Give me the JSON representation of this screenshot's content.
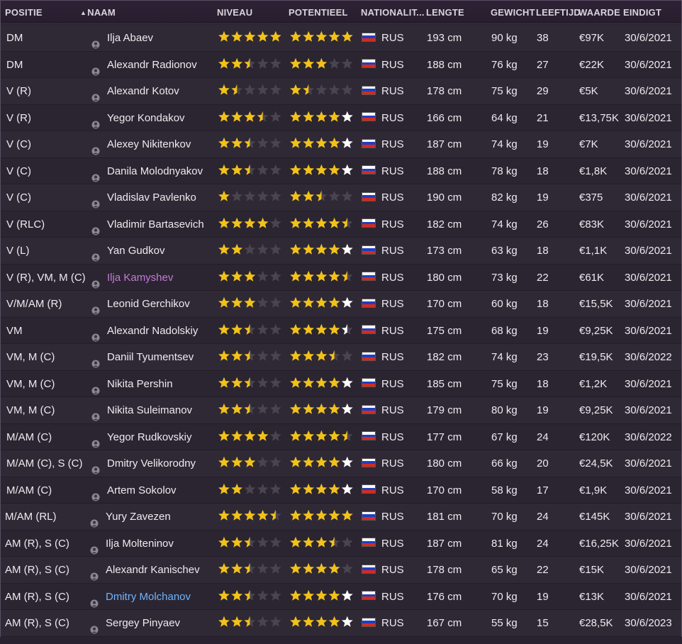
{
  "colors": {
    "header_bg": "#2b2131",
    "row_bg": "#2f2935",
    "star_gold": "#f2c21b",
    "star_white": "#ffffff",
    "star_empty": "#4a4450",
    "name_default": "#ecebee",
    "name_purple": "#c57ad9",
    "name_blue": "#6fb3ff"
  },
  "columns": [
    {
      "label": "POSITIE"
    },
    {
      "label": "NAAM",
      "sort_icon": "triangle-up-icon"
    },
    {
      "label": "NIVEAU"
    },
    {
      "label": "POTENTIEEL"
    },
    {
      "label": "NATIONALIT..."
    },
    {
      "label": "LENGTE"
    },
    {
      "label": "GEWICHT"
    },
    {
      "label": "LEEFTIJD"
    },
    {
      "label": "WAARDE"
    },
    {
      "label": "EINDIGT"
    }
  ],
  "players": [
    {
      "pos": "DM",
      "name": "Ilja Abaev",
      "niveau": 5,
      "pot": 5,
      "pot_white": false,
      "nat": "RUS",
      "len": "193 cm",
      "gew": "90 kg",
      "age": "38",
      "val": "€97K",
      "end": "30/6/2021"
    },
    {
      "pos": "DM",
      "name": "Alexandr Radionov",
      "niveau": 2.5,
      "pot": 3,
      "pot_white": false,
      "nat": "RUS",
      "len": "188 cm",
      "gew": "76 kg",
      "age": "27",
      "val": "€22K",
      "end": "30/6/2021"
    },
    {
      "pos": "V (R)",
      "name": "Alexandr Kotov",
      "niveau": 1.5,
      "pot": 1.5,
      "pot_white": false,
      "nat": "RUS",
      "len": "178 cm",
      "gew": "75 kg",
      "age": "29",
      "val": "€5K",
      "end": "30/6/2021"
    },
    {
      "pos": "V (R)",
      "name": "Yegor Kondakov",
      "niveau": 3.5,
      "pot": 5,
      "pot_white": true,
      "nat": "RUS",
      "len": "166 cm",
      "gew": "64 kg",
      "age": "21",
      "val": "€13,75K",
      "end": "30/6/2021"
    },
    {
      "pos": "V (C)",
      "name": "Alexey Nikitenkov",
      "niveau": 2.5,
      "pot": 5,
      "pot_white": true,
      "nat": "RUS",
      "len": "187 cm",
      "gew": "74 kg",
      "age": "19",
      "val": "€7K",
      "end": "30/6/2021"
    },
    {
      "pos": "V (C)",
      "name": "Danila Molodnyakov",
      "niveau": 2.5,
      "pot": 5,
      "pot_white": true,
      "nat": "RUS",
      "len": "188 cm",
      "gew": "78 kg",
      "age": "18",
      "val": "€1,8K",
      "end": "30/6/2021"
    },
    {
      "pos": "V (C)",
      "name": "Vladislav Pavlenko",
      "niveau": 1,
      "pot": 2.5,
      "pot_white": false,
      "nat": "RUS",
      "len": "190 cm",
      "gew": "82 kg",
      "age": "19",
      "val": "€375",
      "end": "30/6/2021"
    },
    {
      "pos": "V (RLC)",
      "name": "Vladimir Bartasevich",
      "niveau": 4,
      "pot": 4.5,
      "pot_white": false,
      "nat": "RUS",
      "len": "182 cm",
      "gew": "74 kg",
      "age": "26",
      "val": "€83K",
      "end": "30/6/2021"
    },
    {
      "pos": "V (L)",
      "name": "Yan Gudkov",
      "niveau": 2,
      "pot": 5,
      "pot_white": true,
      "nat": "RUS",
      "len": "173 cm",
      "gew": "63 kg",
      "age": "18",
      "val": "€1,1K",
      "end": "30/6/2021"
    },
    {
      "pos": "V (R), VM, M (C)",
      "name": "Ilja Kamyshev",
      "name_color": "purple",
      "niveau": 3,
      "pot": 4.5,
      "pot_white": false,
      "nat": "RUS",
      "len": "180 cm",
      "gew": "73 kg",
      "age": "22",
      "val": "€61K",
      "end": "30/6/2021"
    },
    {
      "pos": "V/M/AM (R)",
      "name": "Leonid Gerchikov",
      "niveau": 3,
      "pot": 5,
      "pot_white": true,
      "nat": "RUS",
      "len": "170 cm",
      "gew": "60 kg",
      "age": "18",
      "val": "€15,5K",
      "end": "30/6/2021"
    },
    {
      "pos": "VM",
      "name": "Alexandr Nadolskiy",
      "niveau": 2.5,
      "pot": 4.5,
      "pot_white": true,
      "nat": "RUS",
      "len": "175 cm",
      "gew": "68 kg",
      "age": "19",
      "val": "€9,25K",
      "end": "30/6/2021"
    },
    {
      "pos": "VM, M (C)",
      "name": "Daniil Tyumentsev",
      "niveau": 2.5,
      "pot": 3.5,
      "pot_white": false,
      "nat": "RUS",
      "len": "182 cm",
      "gew": "74 kg",
      "age": "23",
      "val": "€19,5K",
      "end": "30/6/2022"
    },
    {
      "pos": "VM, M (C)",
      "name": "Nikita Pershin",
      "niveau": 2.5,
      "pot": 5,
      "pot_white": true,
      "nat": "RUS",
      "len": "185 cm",
      "gew": "75 kg",
      "age": "18",
      "val": "€1,2K",
      "end": "30/6/2021"
    },
    {
      "pos": "VM, M (C)",
      "name": "Nikita Suleimanov",
      "niveau": 2.5,
      "pot": 5,
      "pot_white": true,
      "nat": "RUS",
      "len": "179 cm",
      "gew": "80 kg",
      "age": "19",
      "val": "€9,25K",
      "end": "30/6/2021"
    },
    {
      "pos": "M/AM (C)",
      "name": "Yegor Rudkovskiy",
      "niveau": 4,
      "pot": 4.5,
      "pot_white": false,
      "nat": "RUS",
      "len": "177 cm",
      "gew": "67 kg",
      "age": "24",
      "val": "€120K",
      "end": "30/6/2022"
    },
    {
      "pos": "M/AM (C), S (C)",
      "name": "Dmitry Velikorodny",
      "niveau": 3,
      "pot": 5,
      "pot_white": true,
      "nat": "RUS",
      "len": "180 cm",
      "gew": "66 kg",
      "age": "20",
      "val": "€24,5K",
      "end": "30/6/2021"
    },
    {
      "pos": "M/AM (C)",
      "name": "Artem Sokolov",
      "niveau": 2,
      "pot": 5,
      "pot_white": true,
      "nat": "RUS",
      "len": "170 cm",
      "gew": "58 kg",
      "age": "17",
      "val": "€1,9K",
      "end": "30/6/2021"
    },
    {
      "pos": "M/AM (RL)",
      "name": "Yury Zavezen",
      "wide": true,
      "niveau": 4.5,
      "pot": 5,
      "pot_white": false,
      "nat": "RUS",
      "len": "181 cm",
      "gew": "70 kg",
      "age": "24",
      "val": "€145K",
      "end": "30/6/2021"
    },
    {
      "pos": "AM (R), S (C)",
      "name": "Ilja Molteninov",
      "wide": true,
      "niveau": 2.5,
      "pot": 3.5,
      "pot_white": false,
      "nat": "RUS",
      "len": "187 cm",
      "gew": "81 kg",
      "age": "24",
      "val": "€16,25K",
      "end": "30/6/2021"
    },
    {
      "pos": "AM (R), S (C)",
      "name": "Alexandr Kanischev",
      "wide": true,
      "niveau": 2.5,
      "pot": 4,
      "pot_white": false,
      "nat": "RUS",
      "len": "178 cm",
      "gew": "65 kg",
      "age": "22",
      "val": "€15K",
      "end": "30/6/2021"
    },
    {
      "pos": "AM (R), S (C)",
      "name": "Dmitry Molchanov",
      "name_color": "blue",
      "wide": true,
      "niveau": 2.5,
      "pot": 5,
      "pot_white": true,
      "nat": "RUS",
      "len": "176 cm",
      "gew": "70 kg",
      "age": "19",
      "val": "€13K",
      "end": "30/6/2021"
    },
    {
      "pos": "AM (R), S (C)",
      "name": "Sergey Pinyaev",
      "wide": true,
      "niveau": 2.5,
      "pot": 5,
      "pot_white": true,
      "nat": "RUS",
      "len": "167 cm",
      "gew": "55 kg",
      "age": "15",
      "val": "€28,5K",
      "end": "30/6/2023"
    }
  ]
}
